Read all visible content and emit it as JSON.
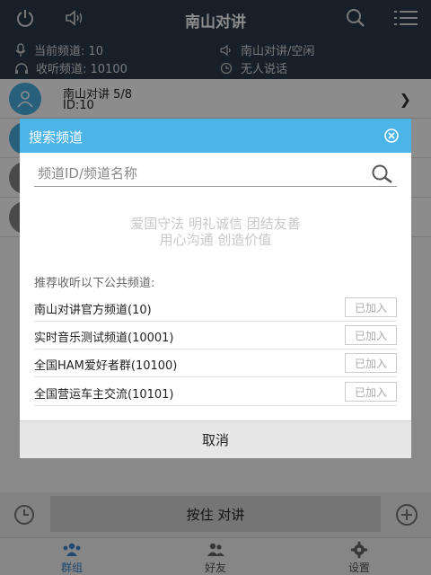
{
  "header": {
    "title": "南山对讲",
    "power_icon": "power-icon",
    "speaker_icon": "speaker-icon",
    "search_icon": "search-icon",
    "menu_icon": "menu-list-icon"
  },
  "status": {
    "current_channel": "当前频道: 10",
    "listen_channel": "收听频道: 10100",
    "channel_state": "南山对讲/空闲",
    "speaker_state": "无人说话"
  },
  "list": {
    "items": [
      {
        "name": "南山对讲 5/8",
        "id": "ID:10"
      }
    ]
  },
  "ptt": {
    "label": "按住 对讲"
  },
  "tabs": [
    {
      "label": "群组"
    },
    {
      "label": "好友"
    },
    {
      "label": "设置"
    }
  ],
  "dialog": {
    "title": "搜索频道",
    "search_placeholder": "频道ID/频道名称",
    "slogan_line1": "爱国守法 明礼诚信 团结友善",
    "slogan_line2": "用心沟通 创造价值",
    "recommend_label": "推荐收听以下公共频道:",
    "channels": [
      {
        "name": "南山对讲官方频道(10)",
        "button": "已加入"
      },
      {
        "name": "实时音乐测试频道(10001)",
        "button": "已加入"
      },
      {
        "name": "全国HAM爱好者群(10100)",
        "button": "已加入"
      },
      {
        "name": "全国营运车主交流(10101)",
        "button": "已加入"
      }
    ],
    "cancel": "取消"
  },
  "colors": {
    "header": "#2a3a4a",
    "accent": "#4db4e8",
    "tab_active": "#3a86c8"
  }
}
